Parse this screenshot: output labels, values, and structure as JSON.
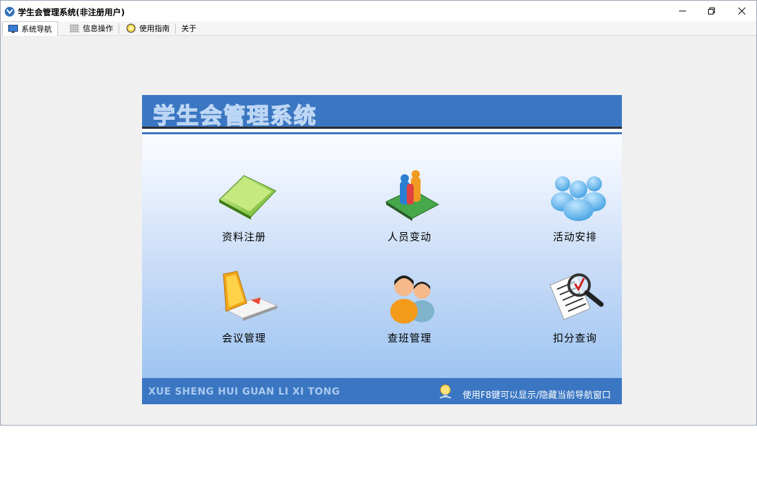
{
  "window": {
    "title": "学生会管理系统(非注册用户)"
  },
  "tabs": [
    {
      "label": "系统导航",
      "icon": "monitor-icon",
      "active": true
    },
    {
      "label": "信息操作",
      "icon": "grid-icon",
      "active": false
    },
    {
      "label": "使用指南",
      "icon": "help-icon",
      "active": false
    },
    {
      "label": "关于",
      "icon": "",
      "active": false
    }
  ],
  "panel": {
    "title": "学生会管理系统",
    "footer_left": "XUE SHENG HUI GUAN LI XI TONG",
    "footer_hint": "使用F8键可以显示/隐藏当前导航窗口",
    "items": [
      {
        "label": "资料注册",
        "icon": "folder-icon"
      },
      {
        "label": "人员变动",
        "icon": "people-change-icon"
      },
      {
        "label": "活动安排",
        "icon": "group-icon"
      },
      {
        "label": "会议管理",
        "icon": "laptop-icon"
      },
      {
        "label": "查班管理",
        "icon": "users-icon"
      },
      {
        "label": "扣分查询",
        "icon": "search-document-icon"
      }
    ]
  },
  "colors": {
    "header_blue": "#3a76c2",
    "window_bg": "#f0f0f0"
  }
}
